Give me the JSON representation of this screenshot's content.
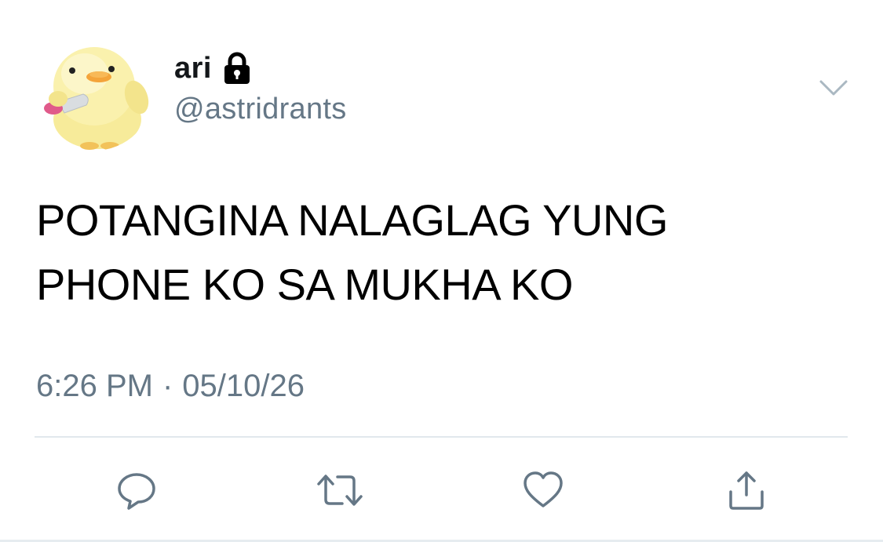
{
  "user": {
    "display_name": "ari",
    "handle": "@astridrants",
    "locked": true,
    "avatar_icon": "yellow-chick-with-knife"
  },
  "tweet": {
    "text_lines": [
      "POTANGINA NALAGLAG YUNG",
      "PHONE KO SA MUKHA KO"
    ],
    "time": "6:26 PM",
    "separator": "·",
    "date": "05/10/26"
  },
  "icons": {
    "menu": "chevron-down-icon",
    "reply": "reply-icon",
    "retweet": "retweet-icon",
    "like": "heart-icon",
    "share": "share-icon"
  },
  "colors": {
    "text": "#000000",
    "secondary": "#657786",
    "divider": "#e1e8ed",
    "icon": "#657786"
  }
}
